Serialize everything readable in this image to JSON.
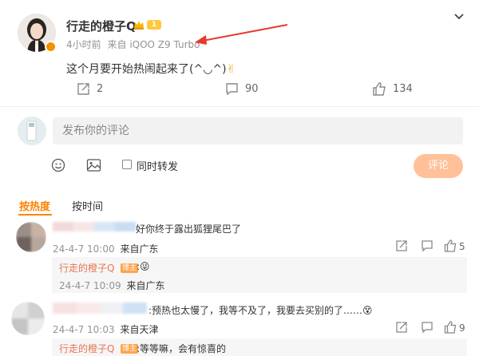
{
  "post": {
    "author": "行走的橙子Q",
    "level": "1",
    "time": "4小时前",
    "source_prefix": "来自",
    "device": "iQOO Z9 Turbo",
    "text": "这个月要开始热闹起来了(^◡^)",
    "emoji": "✌",
    "actions": {
      "repost_count": "2",
      "comment_count": "90",
      "like_count": "134"
    }
  },
  "composer": {
    "placeholder": "发布你的评论",
    "repost_label": "同时转发",
    "submit_label": "评论"
  },
  "tabs": {
    "hot": "按热度",
    "time": "按时间"
  },
  "comments": [
    {
      "text": "好你终于露出狐狸尾巴了",
      "time": "24-4-7 10:00",
      "location": "来自广东",
      "like_count": "5",
      "reply": {
        "user": "行走的橙子Q",
        "badge": "博主",
        "text": ":",
        "emoji": "😜",
        "time": "24-4-7 10:09",
        "location": "来自广东"
      }
    },
    {
      "text": ":预热也太慢了，我等不及了，我要去买别的了……",
      "emoji": "😵",
      "time": "24-4-7 10:03",
      "location": "来自天津",
      "like_count": "9",
      "reply": {
        "user": "行走的橙子Q",
        "badge": "博主",
        "text": ":等等嘛，会有惊喜的"
      }
    }
  ],
  "colors": {
    "accent": "#ff8200",
    "username": "#eb7350",
    "arrow": "#e8392f"
  },
  "icons": [
    "chevron-down-icon",
    "repost-icon",
    "comment-icon",
    "like-icon",
    "emoji-icon",
    "image-icon",
    "crown-icon",
    "verified-badge-icon"
  ]
}
